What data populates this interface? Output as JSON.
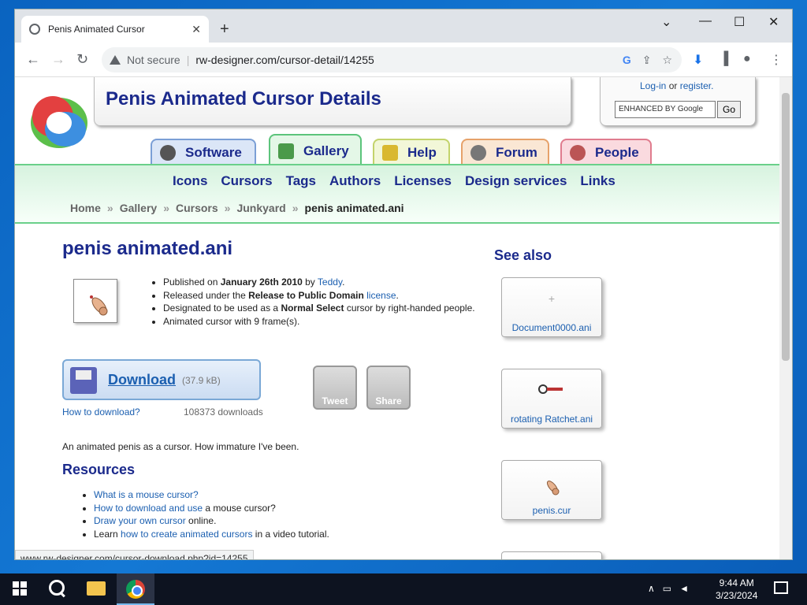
{
  "browser": {
    "tab_title": "Penis Animated Cursor",
    "security_label": "Not secure",
    "url": "rw-designer.com/cursor-detail/14255",
    "status_url": "www.rw-designer.com/cursor-download.php?id=14255"
  },
  "site": {
    "title": "Penis Animated Cursor Details",
    "login": "Log-in",
    "or": "or",
    "register": "register.",
    "search_placeholder": "ENHANCED BY Google",
    "search_go": "Go",
    "tabs": [
      "Software",
      "Gallery",
      "Help",
      "Forum",
      "People"
    ],
    "menu": [
      "Icons",
      "Cursors",
      "Tags",
      "Authors",
      "Licenses",
      "Design services",
      "Links"
    ],
    "breadcrumbs": [
      "Home",
      "Gallery",
      "Cursors",
      "Junkyard",
      "penis animated.ani"
    ]
  },
  "main": {
    "heading": "penis animated.ani",
    "published_prefix": "Published on ",
    "published_date": "January 26th 2010",
    "published_by": " by ",
    "author": "Teddy",
    "released_prefix": "Released under the ",
    "license_name": "Release to Public Domain",
    "license_link": "license",
    "designated_prefix": "Designated to be used as a ",
    "designated_role": "Normal Select",
    "designated_suffix": " cursor by right-handed people.",
    "animated_info": "Animated cursor with 9 frame(s).",
    "download_label": "Download",
    "download_size": "(37.9 kB)",
    "how_to_download": "How to download?",
    "download_count": "108373 downloads",
    "tweet": "Tweet",
    "share": "Share",
    "description": "An animated penis as a cursor. How immature I've been.",
    "resources_heading": "Resources",
    "resources": [
      {
        "link": "What is a mouse cursor?",
        "suffix": ""
      },
      {
        "link": "How to download and use",
        "suffix": " a mouse cursor?"
      },
      {
        "link": "Draw your own cursor",
        "suffix": " online."
      },
      {
        "prefix": "Learn ",
        "link": "how to create animated cursors",
        "suffix": " in a video tutorial."
      }
    ]
  },
  "see_also": {
    "heading": "See also",
    "items": [
      "Document0000.ani",
      "rotating Ratchet.ani",
      "penis.cur"
    ]
  },
  "taskbar": {
    "time": "9:44 AM",
    "date": "3/23/2024"
  }
}
